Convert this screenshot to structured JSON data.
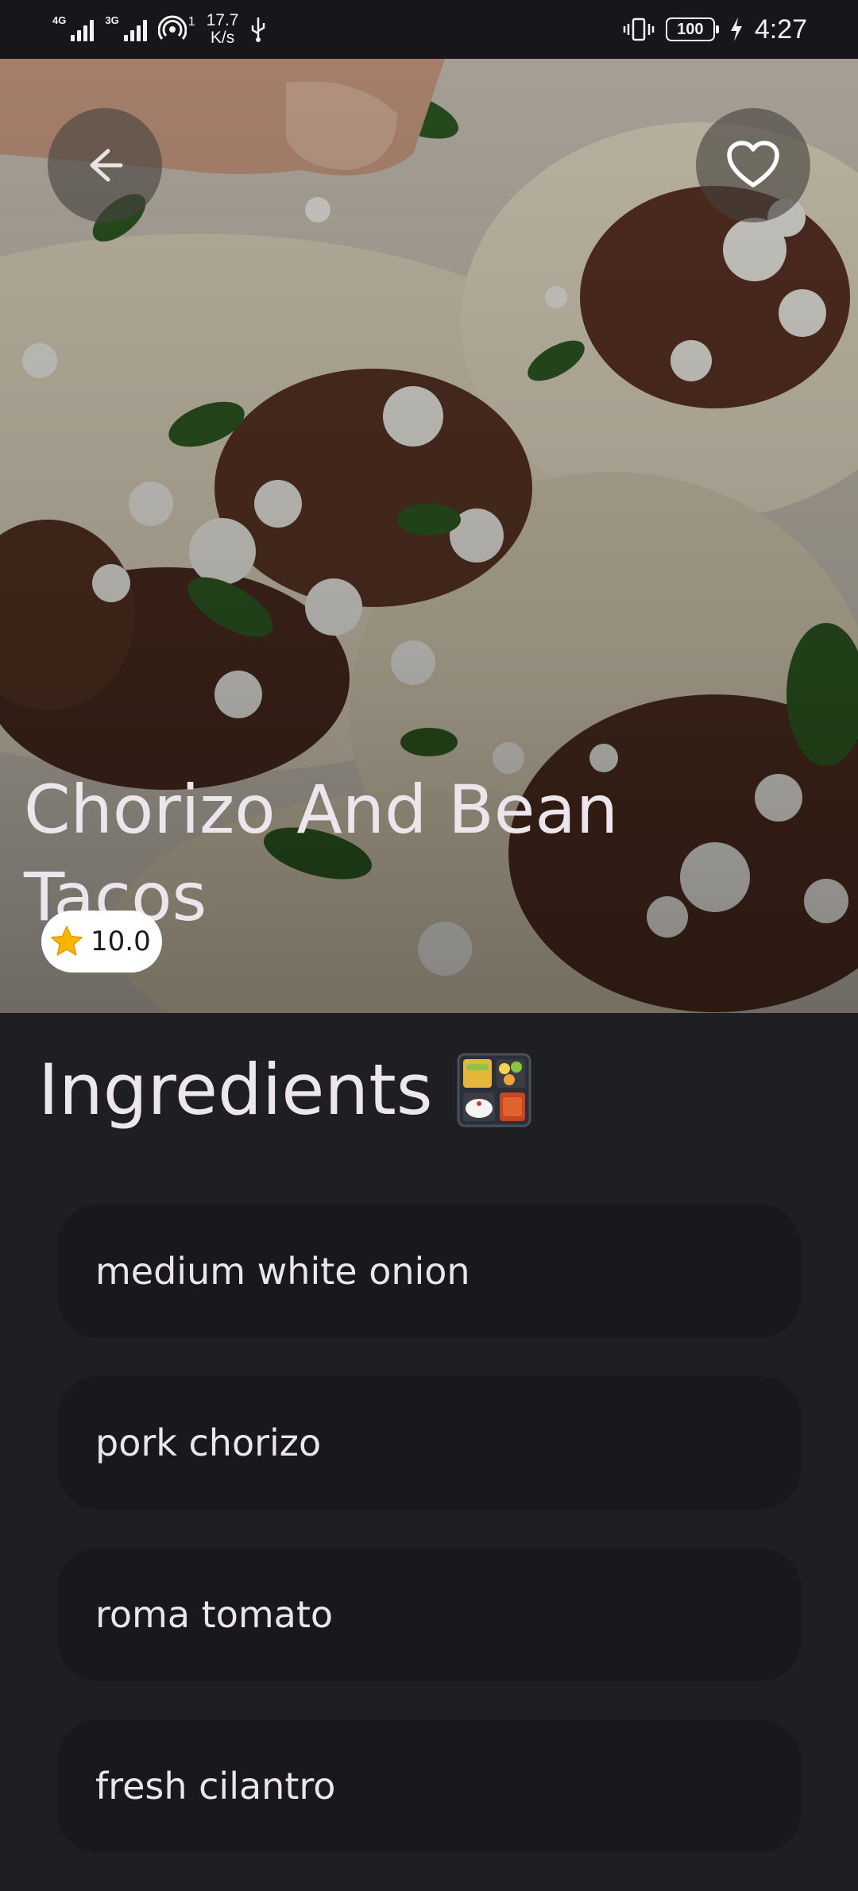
{
  "status_bar": {
    "net1": "4G",
    "net2": "3G",
    "hotspot_count": "1",
    "speed_value": "17.7",
    "speed_unit": "K/s",
    "battery": "100",
    "time": "4:27"
  },
  "recipe": {
    "title": "Chorizo And Bean Tacos",
    "rating": "10.0"
  },
  "ingredients": {
    "heading": "Ingredients",
    "items": [
      "medium white onion",
      "pork chorizo",
      "roma tomato",
      "fresh cilantro"
    ]
  },
  "icons": {
    "back": "arrow-left-icon",
    "favorite": "heart-outline-icon",
    "rating": "star-icon",
    "heading": "bento-box-icon"
  },
  "colors": {
    "background": "#1f1e23",
    "card": "#19181c",
    "star": "#f7b500"
  }
}
